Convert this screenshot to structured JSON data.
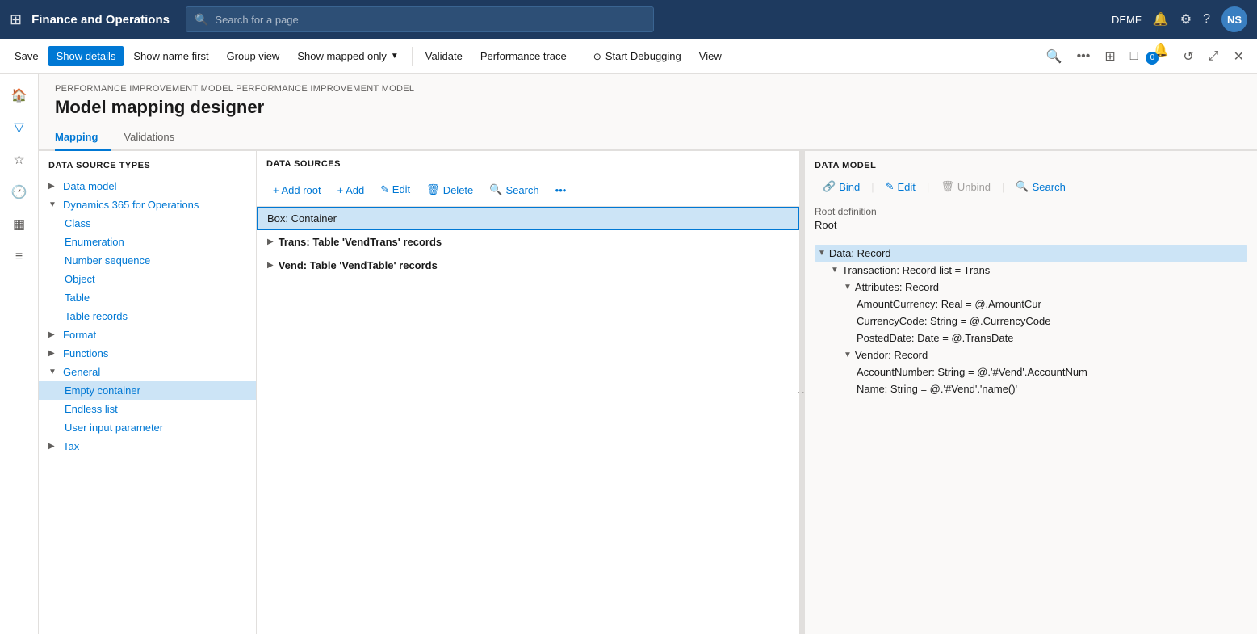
{
  "topbar": {
    "grid_icon": "⊞",
    "brand": "Finance and Operations",
    "search_placeholder": "Search for a page",
    "username": "DEMF",
    "avatar_initials": "NS"
  },
  "commandbar": {
    "save_label": "Save",
    "show_details_label": "Show details",
    "show_name_label": "Show name first",
    "group_view_label": "Group view",
    "show_mapped_label": "Show mapped only",
    "validate_label": "Validate",
    "perf_trace_label": "Performance trace",
    "start_debug_label": "Start Debugging",
    "view_label": "View"
  },
  "breadcrumb": "PERFORMANCE IMPROVEMENT MODEL  PERFORMANCE IMPROVEMENT MODEL",
  "page_title": "Model mapping designer",
  "tabs": [
    {
      "label": "Mapping",
      "active": true
    },
    {
      "label": "Validations",
      "active": false
    }
  ],
  "data_source_types": {
    "panel_header": "DATA SOURCE TYPES",
    "items": [
      {
        "label": "Data model",
        "level": 0,
        "chevron": "▶",
        "type": "leaf"
      },
      {
        "label": "Dynamics 365 for Operations",
        "level": 0,
        "chevron": "▼",
        "type": "expanded"
      },
      {
        "label": "Class",
        "level": 1,
        "type": "leaf"
      },
      {
        "label": "Enumeration",
        "level": 1,
        "type": "leaf"
      },
      {
        "label": "Number sequence",
        "level": 1,
        "type": "leaf"
      },
      {
        "label": "Object",
        "level": 1,
        "type": "leaf"
      },
      {
        "label": "Table",
        "level": 1,
        "type": "leaf"
      },
      {
        "label": "Table records",
        "level": 1,
        "type": "leaf"
      },
      {
        "label": "Format",
        "level": 0,
        "chevron": "▶",
        "type": "collapsed"
      },
      {
        "label": "Functions",
        "level": 0,
        "chevron": "▶",
        "type": "collapsed"
      },
      {
        "label": "General",
        "level": 0,
        "chevron": "▼",
        "type": "expanded"
      },
      {
        "label": "Empty container",
        "level": 1,
        "type": "leaf",
        "selected": true
      },
      {
        "label": "Endless list",
        "level": 1,
        "type": "leaf"
      },
      {
        "label": "User input parameter",
        "level": 1,
        "type": "leaf"
      },
      {
        "label": "Tax",
        "level": 0,
        "chevron": "▶",
        "type": "collapsed"
      }
    ]
  },
  "data_sources": {
    "panel_header": "DATA SOURCES",
    "toolbar": {
      "add_root": "+ Add root",
      "add": "+ Add",
      "edit": "✎ Edit",
      "delete": "🗑 Delete",
      "search": "🔍 Search",
      "more": "•••"
    },
    "items": [
      {
        "label": "Box: Container",
        "selected": true,
        "indent": 0
      },
      {
        "label": "Trans: Table 'VendTrans' records",
        "indent": 0,
        "chevron": "▶"
      },
      {
        "label": "Vend: Table 'VendTable' records",
        "indent": 0,
        "chevron": "▶"
      }
    ]
  },
  "data_model": {
    "panel_header": "DATA MODEL",
    "toolbar": {
      "bind": "Bind",
      "edit": "Edit",
      "unbind": "Unbind",
      "search": "Search"
    },
    "root_definition_label": "Root definition",
    "root_value": "Root",
    "nodes": [
      {
        "label": "Data: Record",
        "level": 0,
        "chevron": "▼",
        "selected": true
      },
      {
        "label": "Transaction: Record list = Trans",
        "level": 1,
        "chevron": "▼"
      },
      {
        "label": "Attributes: Record",
        "level": 2,
        "chevron": "▼"
      },
      {
        "label": "AmountCurrency: Real = @.AmountCur",
        "level": 3
      },
      {
        "label": "CurrencyCode: String = @.CurrencyCode",
        "level": 3
      },
      {
        "label": "PostedDate: Date = @.TransDate",
        "level": 3
      },
      {
        "label": "Vendor: Record",
        "level": 2,
        "chevron": "▼"
      },
      {
        "label": "AccountNumber: String = @.'#Vend'.AccountNum",
        "level": 3
      },
      {
        "label": "Name: String = @.'#Vend'.'name()'",
        "level": 3
      }
    ]
  }
}
